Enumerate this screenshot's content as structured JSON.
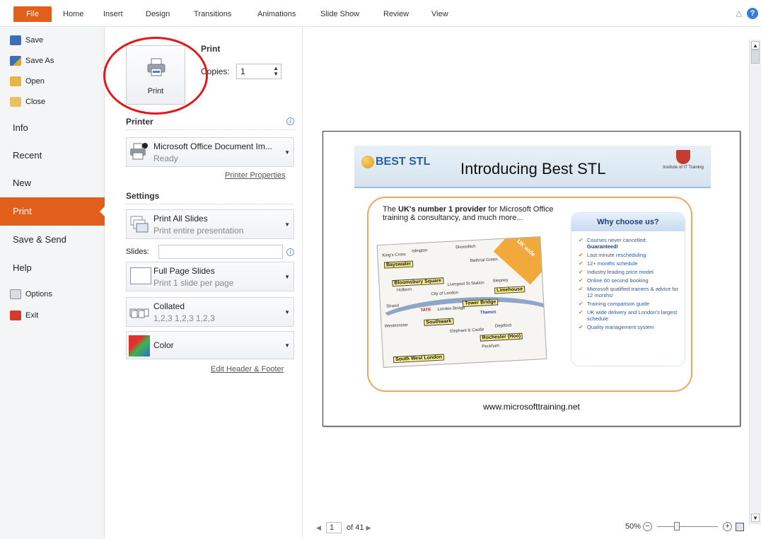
{
  "ribbon": {
    "file": "File",
    "tabs": [
      "Home",
      "Insert",
      "Design",
      "Transitions",
      "Animations",
      "Slide Show",
      "Review",
      "View"
    ],
    "help": "?"
  },
  "nav": {
    "small_top": [
      "Save",
      "Save As",
      "Open",
      "Close"
    ],
    "big": [
      "Info",
      "Recent",
      "New",
      "Print",
      "Save & Send",
      "Help"
    ],
    "small_bottom": [
      "Options",
      "Exit"
    ],
    "active": "Print"
  },
  "print_panel": {
    "button_label": "Print",
    "heading": "Print",
    "copies_label": "Copies:",
    "copies_value": "1",
    "printer_heading": "Printer",
    "printer_name": "Microsoft Office Document Im...",
    "printer_status": "Ready",
    "printer_properties": "Printer Properties",
    "settings_heading": "Settings",
    "slides_dd_title": "Print All Slides",
    "slides_dd_sub": "Print entire presentation",
    "slides_label": "Slides:",
    "layout_title": "Full Page Slides",
    "layout_sub": "Print 1 slide per page",
    "collate_title": "Collated",
    "collate_sub": "1,2,3   1,2,3   1,2,3",
    "color_title": "Color",
    "edit_header_footer": "Edit Header & Footer"
  },
  "slide": {
    "title": "Introducing Best STL",
    "logo_text": "BEST STL",
    "crest_text": "Institute of IT Training",
    "intro_pre": "The ",
    "intro_bold": "UK's number 1 provider",
    "intro_post": " for Microsoft Office training & consultancy, and much more...",
    "map_tags": [
      "Bayswater",
      "Bloomsbury Square",
      "Limehouse",
      "Tower Bridge",
      "Southwark",
      "Rochester (Hoo)",
      "South West London"
    ],
    "map_places": [
      "King's Cross",
      "Islington",
      "Shoreditch",
      "Bethnal Green",
      "Holborn",
      "City of London",
      "Liverpool St Station",
      "Stepney",
      "Strand",
      "London Bridge",
      "Thames",
      "Westminster",
      "Elephant & Castle",
      "Deptford",
      "Peckham",
      "TATE"
    ],
    "corner_text": "UK wide",
    "why_heading": "Why choose us?",
    "why_items": [
      {
        "text": "Courses never cancelled:",
        "bold": "Guaranteed!"
      },
      {
        "text": "Last minute rescheduling",
        "bold": ""
      },
      {
        "text": "12+ months schedule",
        "bold": ""
      },
      {
        "text": "Industry leading price model",
        "bold": ""
      },
      {
        "text": "Online 60 second booking",
        "bold": ""
      },
      {
        "text": "Microsoft qualified trainers & advice for 12 months!",
        "bold": ""
      },
      {
        "text": "Training comparison guide",
        "bold": ""
      },
      {
        "text": "UK wide delivery and London's largest schedule",
        "bold": ""
      },
      {
        "text": "Quality management system",
        "bold": ""
      }
    ],
    "url": "www.microsofttraining.net"
  },
  "footer": {
    "page_value": "1",
    "page_total": "of 41",
    "zoom": "50%"
  },
  "colors": {
    "file_tab": "#e25f1b",
    "active_nav": "#e25f1b",
    "annotation_circle": "#e01a1a"
  }
}
